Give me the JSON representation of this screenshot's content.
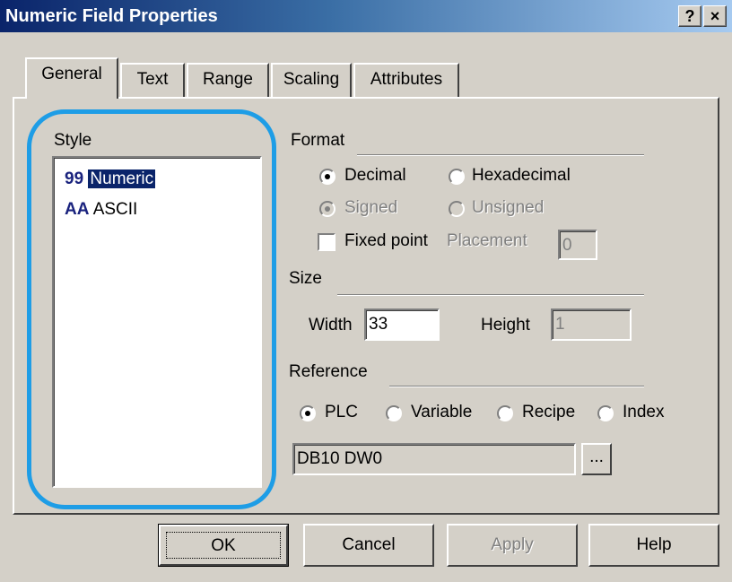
{
  "window": {
    "title": "Numeric Field Properties",
    "help_btn": "?",
    "close_btn": "×"
  },
  "tabs": [
    {
      "label": "General"
    },
    {
      "label": "Text"
    },
    {
      "label": "Range"
    },
    {
      "label": "Scaling"
    },
    {
      "label": "Attributes"
    }
  ],
  "style": {
    "label": "Style",
    "items": [
      {
        "icon": "99",
        "label": "Numeric"
      },
      {
        "icon": "AA",
        "label": "ASCII"
      }
    ]
  },
  "format": {
    "label": "Format",
    "decimal": "Decimal",
    "hexadecimal": "Hexadecimal",
    "signed": "Signed",
    "unsigned": "Unsigned",
    "fixed_point": "Fixed point",
    "placement_label": "Placement",
    "placement_value": "0"
  },
  "size": {
    "label": "Size",
    "width_label": "Width",
    "width_value": "33",
    "height_label": "Height",
    "height_value": "1"
  },
  "reference": {
    "label": "Reference",
    "options": [
      "PLC",
      "Variable",
      "Recipe",
      "Index"
    ],
    "address": "DB10 DW0",
    "browse": "..."
  },
  "buttons": {
    "ok": "OK",
    "cancel": "Cancel",
    "apply": "Apply",
    "help": "Help"
  },
  "colors": {
    "highlight": "#1e9de6",
    "selection": "#0a246a"
  }
}
